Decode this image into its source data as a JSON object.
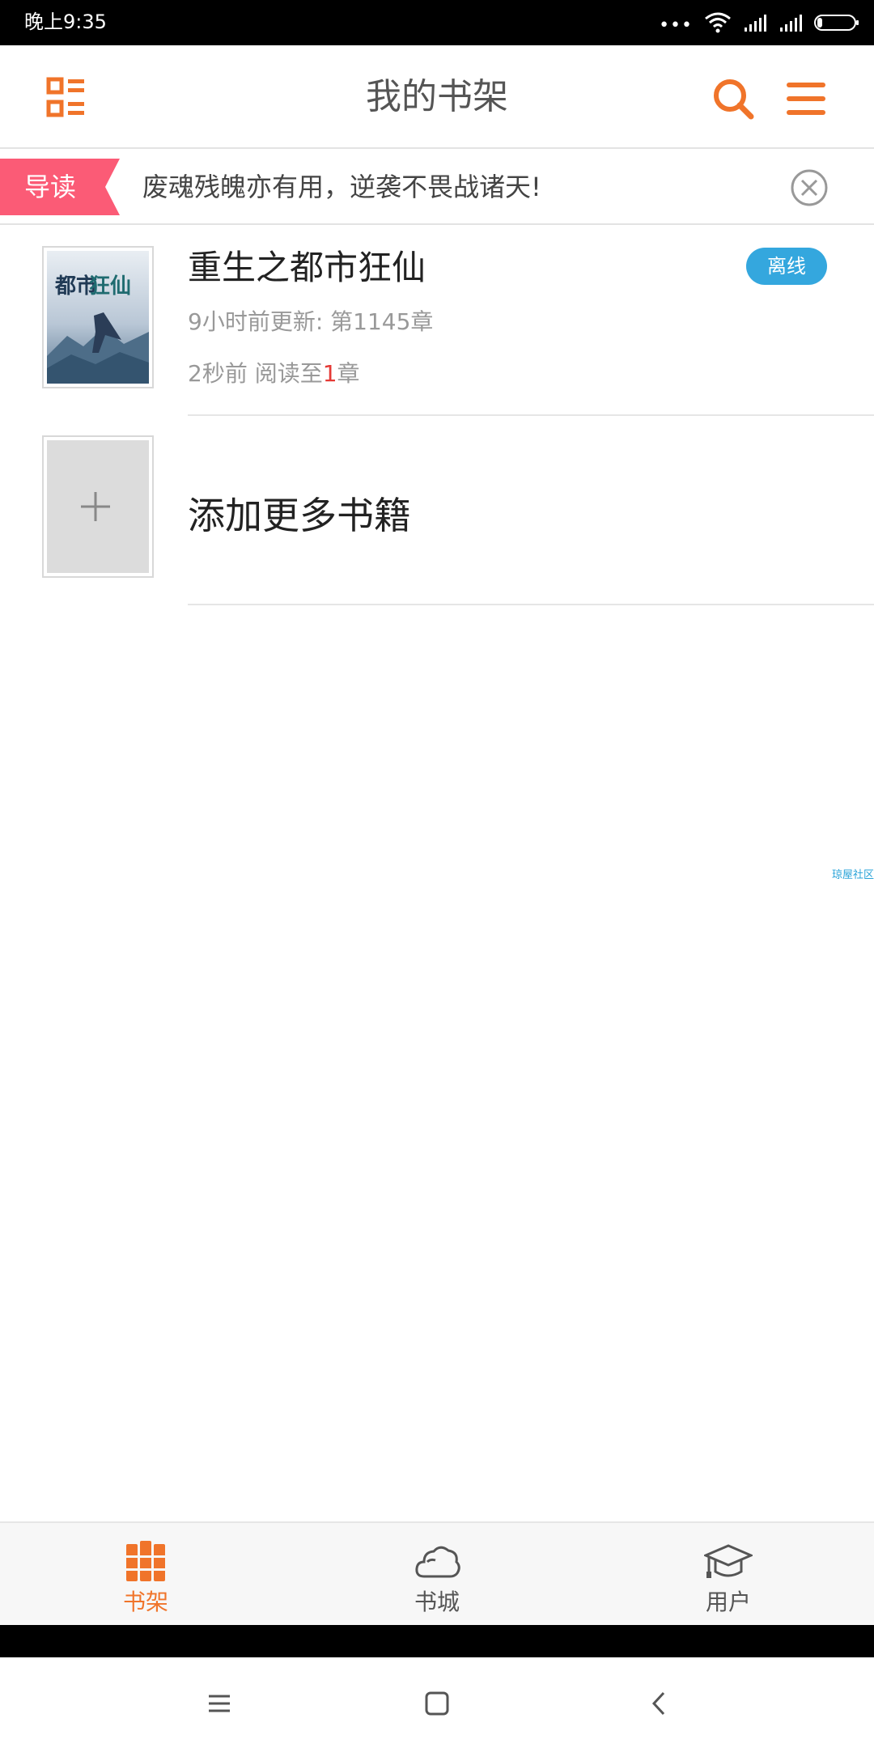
{
  "status_bar": {
    "time": "晚上9:35",
    "icons": [
      "dots-icon",
      "wifi-icon",
      "signal-icon",
      "signal-icon",
      "battery-icon"
    ]
  },
  "header": {
    "title": "我的书架",
    "left_icon": "bookshelf-grid-icon",
    "search_icon": "search-icon",
    "menu_icon": "hamburger-menu-icon",
    "accent": "#f0742a"
  },
  "guide": {
    "tag": "导读",
    "tag_color": "#fb5b76",
    "headline": "废魂残魄亦有用，逆袭不畏战诸天!"
  },
  "books": [
    {
      "title": "重生之都市狂仙",
      "update": "9小时前更新: 第1145章",
      "read_prefix": "2秒前 阅读至",
      "read_chapter": "1",
      "read_suffix": "章",
      "badge": "离线"
    }
  ],
  "add_more": {
    "label": "添加更多书籍"
  },
  "watermark": "琼屋社区",
  "tabs": [
    {
      "label": "书架",
      "icon": "bookshelf-icon",
      "active": true
    },
    {
      "label": "书城",
      "icon": "cloud-icon",
      "active": false
    },
    {
      "label": "用户",
      "icon": "graduation-cap-icon",
      "active": false
    }
  ],
  "navbar": {
    "icons": [
      "menu-lines-icon",
      "home-square-icon",
      "back-chevron-icon"
    ]
  }
}
